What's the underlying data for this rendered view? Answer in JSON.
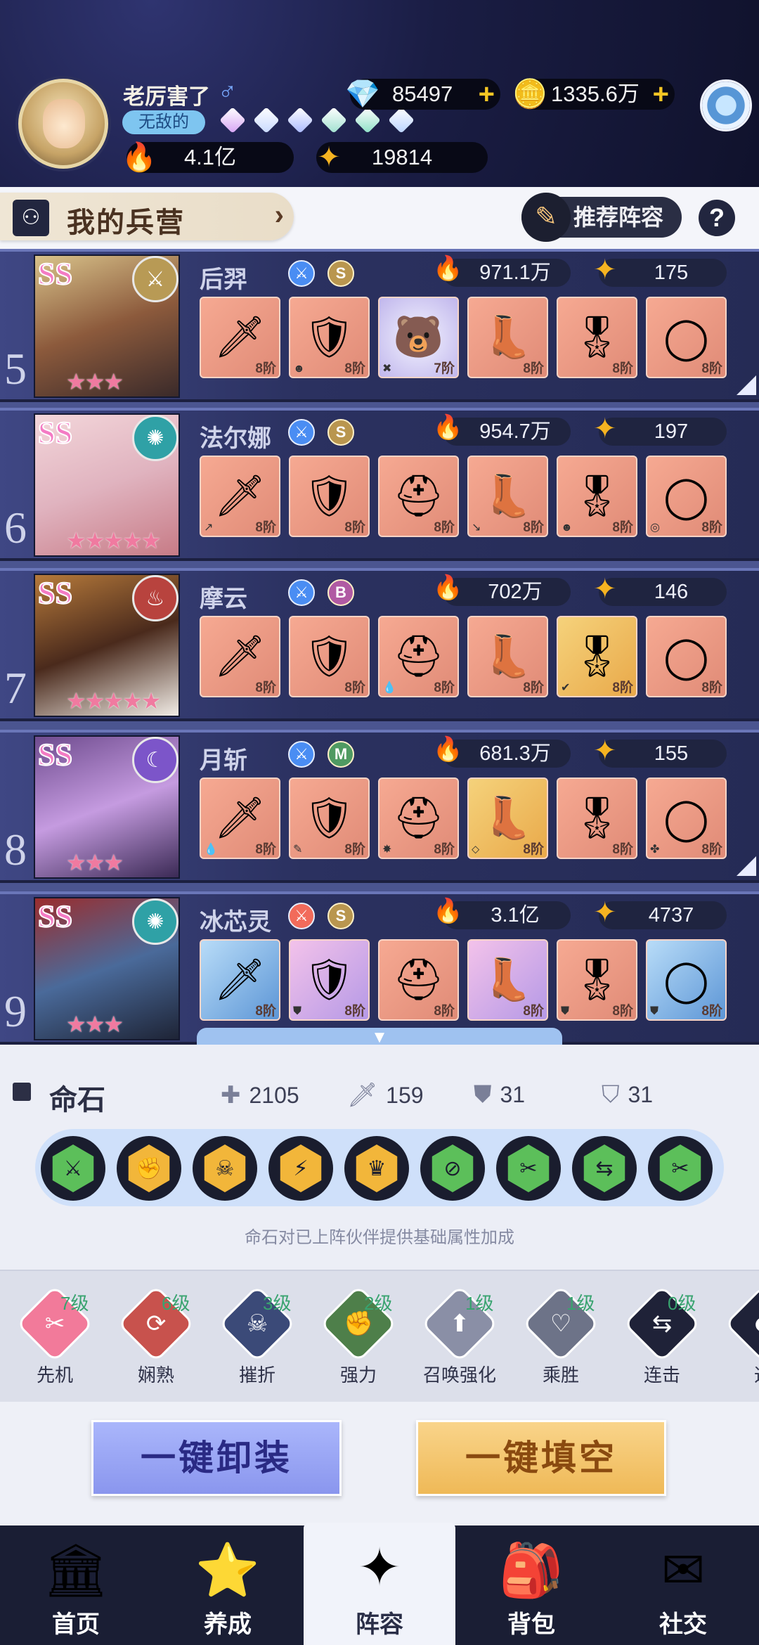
{
  "profile": {
    "username": "老厉害了",
    "gender_symbol": "♂",
    "title_badge": "无敌的",
    "diamonds": "85497",
    "gold": "1335.6万",
    "combat_power": "4.1亿",
    "stars": "19814",
    "gem_colors": [
      "#d6a3f5",
      "#c8d9ff",
      "#a9b9ff",
      "#9fe0cf",
      "#8de0c6",
      "#b9d3ff"
    ]
  },
  "barracks": {
    "title": "我的兵营",
    "recommend_label": "推荐阵容",
    "help_label": "?"
  },
  "heroes": [
    {
      "index": "5",
      "rank": "SS",
      "name": "后羿",
      "grade": "S",
      "power": "971.1万",
      "level": "175",
      "stars": "★★★",
      "faction_icon": "⚔",
      "faction_color": "#b89a55",
      "equips": [
        {
          "icon": "🗡",
          "tier": "8阶",
          "mark": "",
          "style": ""
        },
        {
          "icon": "🛡",
          "tier": "8阶",
          "mark": "☻",
          "style": ""
        },
        {
          "icon": "🐻",
          "tier": "7阶",
          "mark": "✖",
          "style": "special"
        },
        {
          "icon": "👢",
          "tier": "8阶",
          "mark": "",
          "style": ""
        },
        {
          "icon": "🎖",
          "tier": "8阶",
          "mark": "",
          "style": ""
        },
        {
          "icon": "◯",
          "tier": "8阶",
          "mark": "",
          "style": ""
        }
      ]
    },
    {
      "index": "6",
      "rank": "SS",
      "name": "法尔娜",
      "grade": "S",
      "power": "954.7万",
      "level": "197",
      "stars": "★★★★★",
      "faction_icon": "✺",
      "faction_color": "#2fa1a6",
      "equips": [
        {
          "icon": "🗡",
          "tier": "8阶",
          "mark": "↗",
          "style": ""
        },
        {
          "icon": "🛡",
          "tier": "8阶",
          "mark": "",
          "style": ""
        },
        {
          "icon": "⛑",
          "tier": "8阶",
          "mark": "",
          "style": ""
        },
        {
          "icon": "👢",
          "tier": "8阶",
          "mark": "↘",
          "style": ""
        },
        {
          "icon": "🎖",
          "tier": "8阶",
          "mark": "☻",
          "style": ""
        },
        {
          "icon": "◯",
          "tier": "8阶",
          "mark": "◎",
          "style": ""
        }
      ]
    },
    {
      "index": "7",
      "rank": "SS",
      "name": "摩云",
      "grade": "B",
      "power": "702万",
      "level": "146",
      "stars": "★★★★★",
      "faction_icon": "♨",
      "faction_color": "#b8433e",
      "equips": [
        {
          "icon": "🗡",
          "tier": "8阶",
          "mark": "",
          "style": ""
        },
        {
          "icon": "🛡",
          "tier": "8阶",
          "mark": "",
          "style": ""
        },
        {
          "icon": "⛑",
          "tier": "8阶",
          "mark": "💧",
          "style": ""
        },
        {
          "icon": "👢",
          "tier": "8阶",
          "mark": "",
          "style": ""
        },
        {
          "icon": "🎖",
          "tier": "8阶",
          "mark": "✔",
          "style": "gold"
        },
        {
          "icon": "◯",
          "tier": "8阶",
          "mark": "",
          "style": ""
        }
      ]
    },
    {
      "index": "8",
      "rank": "SS",
      "name": "月斩",
      "grade": "M",
      "power": "681.3万",
      "level": "155",
      "stars": "★★★",
      "faction_icon": "☾",
      "faction_color": "#7c55c9",
      "equips": [
        {
          "icon": "🗡",
          "tier": "8阶",
          "mark": "💧",
          "style": ""
        },
        {
          "icon": "🛡",
          "tier": "8阶",
          "mark": "✎",
          "style": ""
        },
        {
          "icon": "⛑",
          "tier": "8阶",
          "mark": "✸",
          "style": ""
        },
        {
          "icon": "👢",
          "tier": "8阶",
          "mark": "⬦",
          "style": "gold"
        },
        {
          "icon": "🎖",
          "tier": "8阶",
          "mark": "",
          "style": ""
        },
        {
          "icon": "◯",
          "tier": "8阶",
          "mark": "✤",
          "style": ""
        }
      ]
    },
    {
      "index": "9",
      "rank": "SS",
      "name": "冰芯灵",
      "grade": "S",
      "power": "3.1亿",
      "level": "4737",
      "stars": "★★★",
      "faction_icon": "✺",
      "faction_color": "#2fa1a6",
      "equips": [
        {
          "icon": "🗡",
          "tier": "8阶",
          "mark": "",
          "style": "blue"
        },
        {
          "icon": "🛡",
          "tier": "8阶",
          "mark": "⛊",
          "style": "pink"
        },
        {
          "icon": "⛑",
          "tier": "8阶",
          "mark": "",
          "style": ""
        },
        {
          "icon": "👢",
          "tier": "8阶",
          "mark": "",
          "style": "pink"
        },
        {
          "icon": "🎖",
          "tier": "8阶",
          "mark": "⛊",
          "style": ""
        },
        {
          "icon": "◯",
          "tier": "8阶",
          "mark": "⛊",
          "style": "blue"
        }
      ]
    }
  ],
  "scroll_indicator": "▼",
  "stone_section": {
    "title": "命石",
    "hp": "2105",
    "attack": "159",
    "defense": "31",
    "magic_defense": "31",
    "note": "命石对已上阵伙伴提供基础属性加成",
    "stones": [
      {
        "icon": "⚔",
        "color": "#5cbf5a"
      },
      {
        "icon": "✊",
        "color": "#f2b63a"
      },
      {
        "icon": "☠",
        "color": "#f2b63a"
      },
      {
        "icon": "⚡",
        "color": "#f2b63a"
      },
      {
        "icon": "♛",
        "color": "#f2b63a"
      },
      {
        "icon": "⊘",
        "color": "#5cbf5a"
      },
      {
        "icon": "✂",
        "color": "#5cbf5a"
      },
      {
        "icon": "⇆",
        "color": "#5cbf5a"
      },
      {
        "icon": "✂",
        "color": "#5cbf5a"
      }
    ]
  },
  "skills": [
    {
      "name": "先机",
      "level": "7级",
      "icon": "✂",
      "color": "#f27a9a"
    },
    {
      "name": "娴熟",
      "level": "6级",
      "icon": "⟳",
      "color": "#c8524d"
    },
    {
      "name": "摧折",
      "level": "3级",
      "icon": "☠",
      "color": "#3b4a78"
    },
    {
      "name": "强力",
      "level": "2级",
      "icon": "✊",
      "color": "#4e7f4a"
    },
    {
      "name": "召唤强化",
      "level": "1级",
      "icon": "⬆",
      "color": "#8a8fa6"
    },
    {
      "name": "乘胜",
      "level": "1级",
      "icon": "♡",
      "color": "#6d7388"
    },
    {
      "name": "连击",
      "level": "0级",
      "icon": "⇆",
      "color": "#1f2238"
    },
    {
      "name": "迅",
      "level": "",
      "icon": "☻",
      "color": "#1f2238"
    }
  ],
  "actions": {
    "unequip_all": "一键卸装",
    "fill_all": "一键填空"
  },
  "nav": [
    {
      "label": "首页",
      "icon": "🏛",
      "active": false
    },
    {
      "label": "养成",
      "icon": "⭐",
      "active": false
    },
    {
      "label": "阵容",
      "icon": "✦",
      "active": true
    },
    {
      "label": "背包",
      "icon": "🎒",
      "active": false
    },
    {
      "label": "社交",
      "icon": "✉",
      "active": false
    }
  ]
}
